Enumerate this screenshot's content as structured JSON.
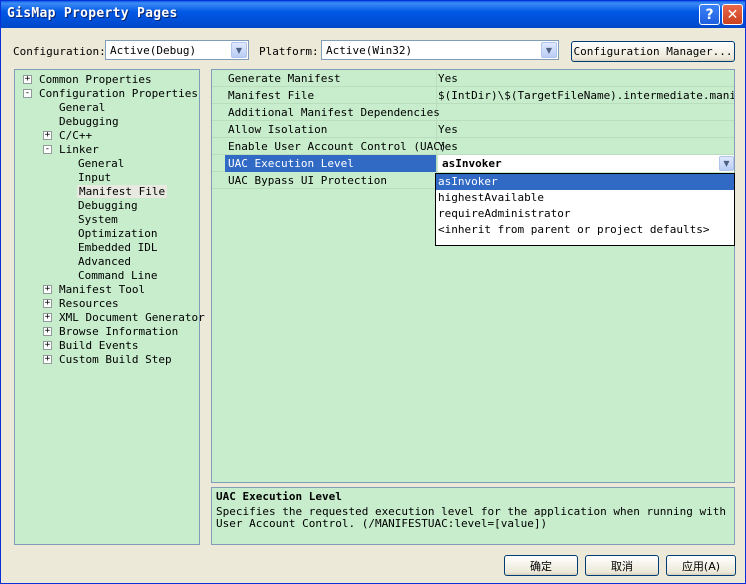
{
  "window": {
    "title": "GisMap Property Pages"
  },
  "titlebar": {
    "help": "?",
    "close": "✕"
  },
  "config": {
    "config_label": "Configuration:",
    "config_value": "Active(Debug)",
    "platform_label": "Platform:",
    "platform_value": "Active(Win32)",
    "manager_button": "Configuration Manager..."
  },
  "tree": {
    "common": "Common Properties",
    "config_props": "Configuration Properties",
    "general": "General",
    "debugging": "Debugging",
    "cpp": "C/C++",
    "linker": "Linker",
    "linker_general": "General",
    "linker_input": "Input",
    "linker_manifest": "Manifest File",
    "linker_debugging": "Debugging",
    "linker_system": "System",
    "linker_optimization": "Optimization",
    "linker_embedded_idl": "Embedded IDL",
    "linker_advanced": "Advanced",
    "linker_cmdline": "Command Line",
    "manifest_tool": "Manifest Tool",
    "resources": "Resources",
    "xml_doc": "XML Document Generator",
    "browse": "Browse Information",
    "build_events": "Build Events",
    "custom_build": "Custom Build Step",
    "plus": "+",
    "minus": "-"
  },
  "grid": {
    "rows": [
      {
        "name": "Generate Manifest",
        "value": "Yes"
      },
      {
        "name": "Manifest File",
        "value": "$(IntDir)\\$(TargetFileName).intermediate.manifest"
      },
      {
        "name": "Additional Manifest Dependencies",
        "value": ""
      },
      {
        "name": "Allow Isolation",
        "value": "Yes"
      },
      {
        "name": "Enable User Account Control (UAC)",
        "value": "Yes"
      },
      {
        "name": "UAC Execution Level",
        "value": "asInvoker"
      },
      {
        "name": "UAC Bypass UI Protection",
        "value": ""
      }
    ]
  },
  "dropdown": {
    "options": [
      "asInvoker",
      "highestAvailable",
      "requireAdministrator",
      "<inherit from parent or project defaults>"
    ]
  },
  "description": {
    "title": "UAC Execution Level",
    "text": "Specifies the requested execution level for the application when running with User Account Control.  (/MANIFESTUAC:level=[value])"
  },
  "buttons": {
    "ok": "确定",
    "cancel": "取消",
    "apply": "应用(A)"
  }
}
